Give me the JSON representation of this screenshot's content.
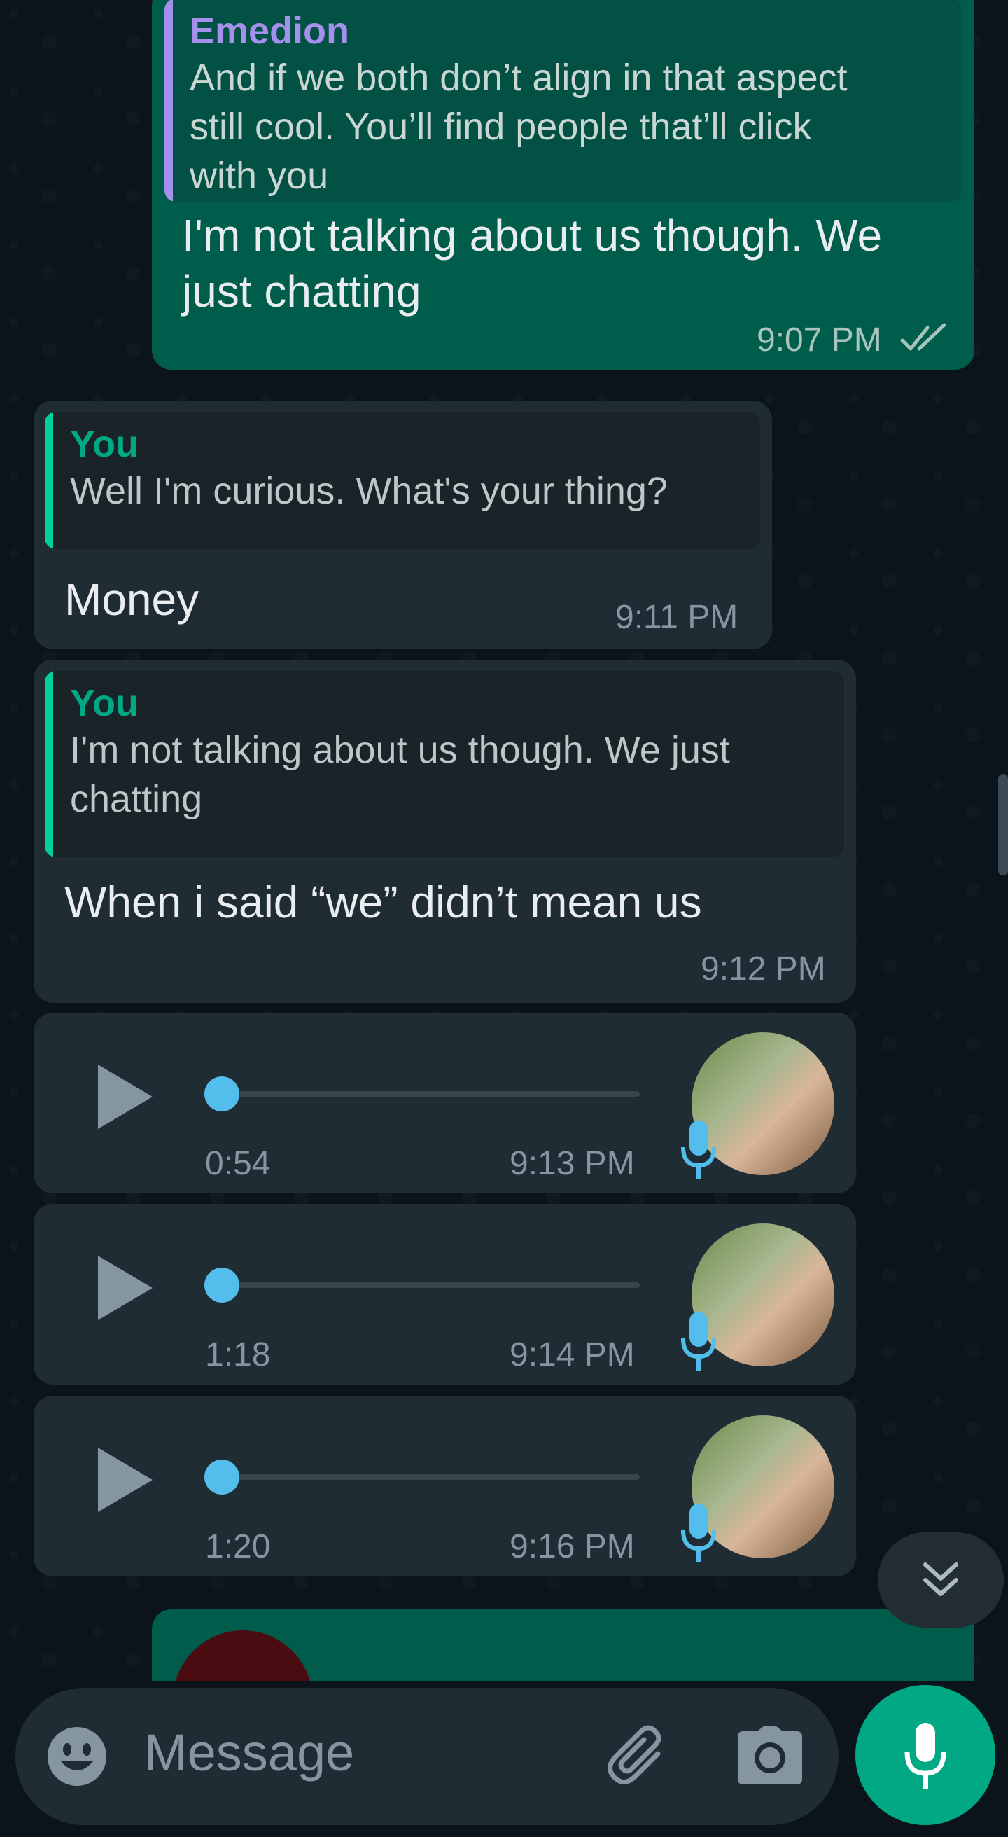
{
  "messages": [
    {
      "quote_author": "Emedion",
      "quote_text_lines": [
        "And if we both don’t align in that aspect",
        "still cool. You’ll find people that’ll click",
        "with you"
      ],
      "text_lines": [
        "I'm not talking about us though. We",
        "just chatting"
      ],
      "time": "9:07 PM"
    },
    {
      "quote_author": "You",
      "quote_text": "Well I'm curious. What's your thing?",
      "text": "Money",
      "time": "9:11 PM"
    },
    {
      "quote_author": "You",
      "quote_text_lines": [
        "I'm not talking about us though. We just",
        "chatting"
      ],
      "text": "When i said “we” didn’t mean us",
      "time": "9:12 PM"
    }
  ],
  "voice_notes": [
    {
      "duration": "0:54",
      "time": "9:13 PM",
      "progress": 0
    },
    {
      "duration": "1:18",
      "time": "9:14 PM",
      "progress": 0
    },
    {
      "duration": "1:20",
      "time": "9:16 PM",
      "progress": 0
    }
  ],
  "composer": {
    "placeholder": "Message",
    "icons": [
      "emoji-icon",
      "paperclip-icon",
      "camera-icon",
      "microphone-icon"
    ]
  },
  "colors": {
    "outgoing_bubble": "#005c4b",
    "incoming_bubble": "#202c33",
    "accent": "#00a884",
    "voice_accent": "#53bdeb",
    "quote_author_purple": "#a591ec"
  }
}
